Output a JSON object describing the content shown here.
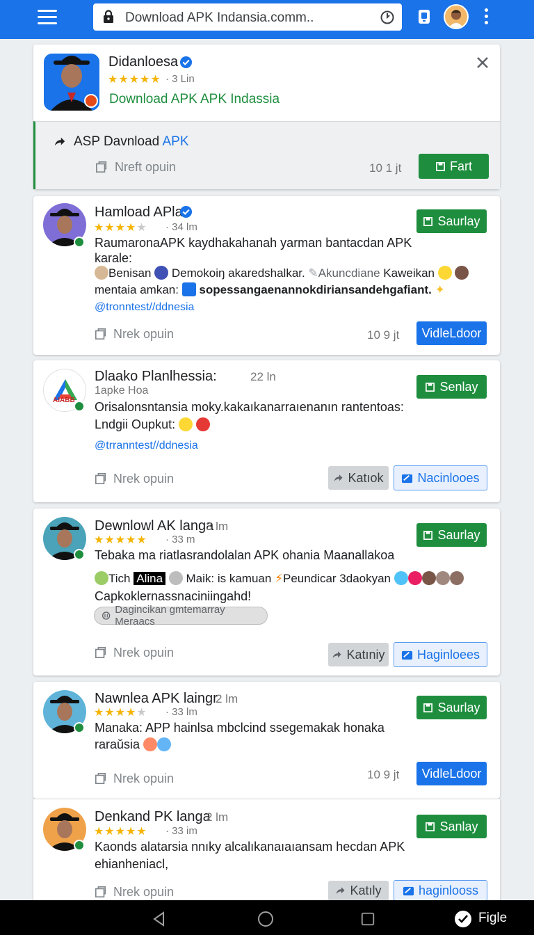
{
  "browser": {
    "url": "Download APK Indansia.comm..",
    "icons": [
      "menu-icon",
      "lock-icon",
      "reload-icon",
      "tab-switcher-icon",
      "profile-avatar",
      "more-vert-icon"
    ]
  },
  "featured": {
    "title": "Didanloesa",
    "rating_text": "3 Lin",
    "link": "Download APK APK Indassia",
    "download_row_title_prefix": "ASP Davnload",
    "download_row_title_suffix": "APK",
    "footer_label": "Nreft opuin",
    "time": "10 1 jt",
    "action": "Fart"
  },
  "posts": [
    {
      "title": "Hamload APla",
      "stars": 4,
      "meta": "34 lm",
      "body_line1": "RaumaronaAPK kaydhakahanah yarman bantacdan APK",
      "body_line2": "karale:",
      "line3_a": "Benisan",
      "line3_b": "Demokoiŋ akaredshalkar.",
      "line3_c": "Akuncdiane",
      "line3_d": "Kaweikan",
      "line4_a": "mentaia amkan:",
      "line4_b": "sopessangaenannokdiriansandehgafiant.",
      "handle": "@tronntest//ddnesia",
      "footer_label": "Nrek opuin",
      "time": "10 9 jt",
      "primary_action": "Saurlay",
      "secondary_action": "VidleLdoor"
    },
    {
      "title": "Dlaako Planlhessia:",
      "meta": "22 ln",
      "subtitle": "1apke Hoa",
      "body_line1": "Orisalonsntansia moky.kakaıkanarraıenanın rantentoas:",
      "body_line2": "Lndgii Oupkut:",
      "handle": "@trranntest//ddnesia",
      "footer_label": "Nrek opuin",
      "primary_action": "Senlay",
      "grey_action": "Katıok",
      "outline_action": "Nacinlooes",
      "logo_text": "AIABB"
    },
    {
      "title": "Dewnlowl AK langa",
      "stars": 5,
      "meta_title": "3 lm",
      "meta": "33 m",
      "body_line1": "Tebaka ma riatlasrandolalan APK ohania Maanallakoa",
      "line2_a": "Tich",
      "line2_b": "Alina",
      "line2_c": "Maik: is kamuan",
      "line2_d": "Peundicar 3daokyan",
      "body_line3": "Capkoklernassnaciniingahd!",
      "chip": "Dagincikan gmtemarray Meraacs",
      "footer_label": "Nrek opuin",
      "primary_action": "Saurlay",
      "grey_action": "Katıniy",
      "outline_action": "Haginloees"
    },
    {
      "title": "Nawnlea APK laingr",
      "stars": 4,
      "meta_title": "2 lm",
      "meta": "33 lm",
      "body_line1": "Manaka: APP hainlsa mbclcind ssegemakak honaka",
      "body_line2": "raraŭsia",
      "footer_label": "Nrek opuin",
      "time": "10 9 jt",
      "primary_action": "Saurlay",
      "secondary_action": "VidleLdoor"
    },
    {
      "title": "Denkand PK langa",
      "stars": 5,
      "meta_title": "2 lm",
      "meta": "33 im",
      "body_line1": "Kaonds alatarsia nnıky alcalıkanaıaıansam hecdan APK",
      "body_line2": "ehianheniacl,",
      "footer_label": "Nrek opuin",
      "primary_action": "Sanlay",
      "grey_action": "Katıly",
      "outline_action": "haginlooss"
    }
  ],
  "navbar": {
    "right_label": "Figle"
  },
  "colors": {
    "brand_blue": "#1a73e8",
    "action_green": "#1e8e3e",
    "star_yellow": "#f4b400"
  }
}
